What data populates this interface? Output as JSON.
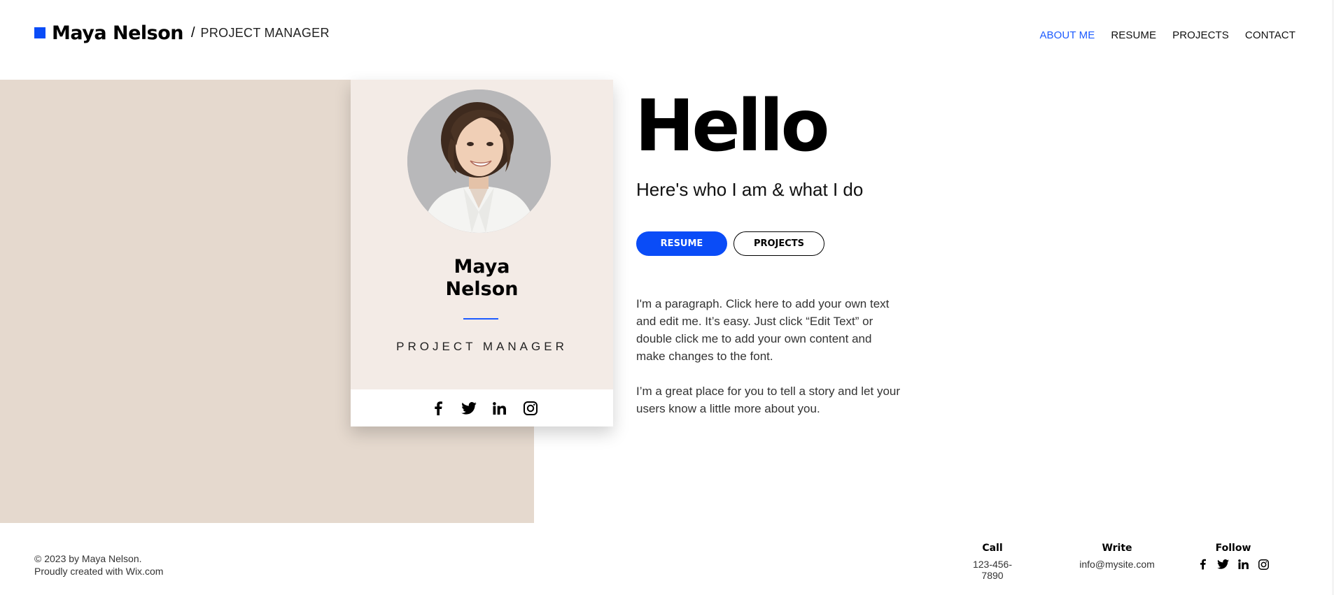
{
  "header": {
    "brand_name": "Maya Nelson",
    "separator": "/",
    "brand_role": "PROJECT MANAGER",
    "nav": [
      {
        "label": "ABOUT ME",
        "active": true
      },
      {
        "label": "RESUME",
        "active": false
      },
      {
        "label": "PROJECTS",
        "active": false
      },
      {
        "label": "CONTACT",
        "active": false
      }
    ]
  },
  "profile_card": {
    "name_line1": "Maya",
    "name_line2": "Nelson",
    "role": "PROJECT MANAGER",
    "social_icons": [
      "facebook-icon",
      "twitter-icon",
      "linkedin-icon",
      "instagram-icon"
    ]
  },
  "main": {
    "heading": "Hello",
    "subtitle": "Here's who I am & what I do",
    "buttons": {
      "resume": "RESUME",
      "projects": "PROJECTS"
    },
    "paragraph1": "I'm a paragraph. Click here to add your own text and edit me. It’s easy. Just click “Edit Text” or double click me to add your own content and make changes to the font.",
    "paragraph2": "I’m a great place for you to tell a story and let your users know a little more about you."
  },
  "footer": {
    "copyright_line1": "© 2023 by Maya Nelson.",
    "copyright_line2": "Proudly created with Wix.com",
    "call_title": "Call",
    "call_value": "123-456-7890",
    "write_title": "Write",
    "write_value": "info@mysite.com",
    "follow_title": "Follow"
  },
  "colors": {
    "accent": "#0a4cf7",
    "beige_panel": "#e5d9ce",
    "card_bg": "#f3ebe6"
  }
}
